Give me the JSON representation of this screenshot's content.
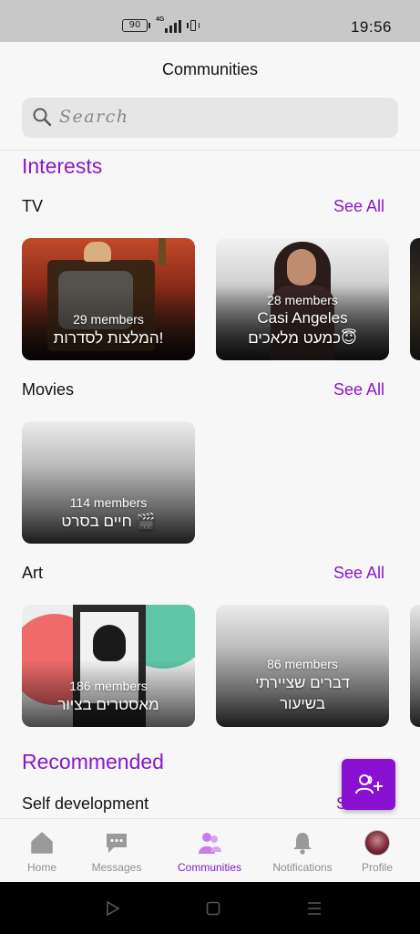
{
  "status_bar": {
    "battery": "90",
    "network": "4G",
    "time": "19:56"
  },
  "header": {
    "title": "Communities"
  },
  "search": {
    "placeholder": "Search"
  },
  "sections": {
    "interests_title": "Interests",
    "recommended_title": "Recommended"
  },
  "categories": [
    {
      "title": "TV",
      "see_all": "See All",
      "cards": [
        {
          "members": "29 members",
          "name": "המלצות לסדרות!"
        },
        {
          "members": "28 members",
          "name": "Casi Angeles",
          "name2": "כמעט מלאכים😇"
        }
      ]
    },
    {
      "title": "Movies",
      "see_all": "See All",
      "cards": [
        {
          "members": "114 members",
          "name": "חיים בסרט 🎬"
        }
      ]
    },
    {
      "title": "Art",
      "see_all": "See All",
      "cards": [
        {
          "members": "186 members",
          "name": "מאסטרים בציור"
        },
        {
          "members": "86 members",
          "name": "דברים שציירתי",
          "name2": "בשיעור"
        }
      ]
    }
  ],
  "recommended": {
    "category_title": "Self development",
    "see_all_partial": "S"
  },
  "bottom_nav": [
    {
      "label": "Home",
      "icon": "home-icon"
    },
    {
      "label": "Messages",
      "icon": "messages-icon"
    },
    {
      "label": "Communities",
      "icon": "communities-icon",
      "active": true
    },
    {
      "label": "Notifications",
      "icon": "bell-icon"
    },
    {
      "label": "Profile",
      "icon": "avatar"
    }
  ],
  "colors": {
    "accent": "#8a18c8",
    "fab": "#8a10d2",
    "inactive": "#8e8e8e"
  }
}
